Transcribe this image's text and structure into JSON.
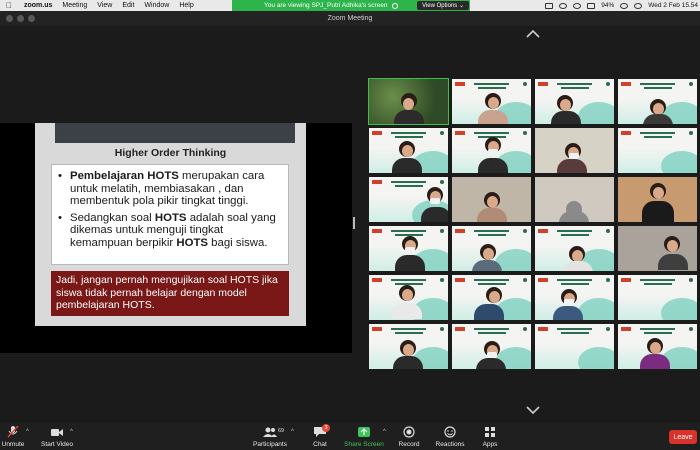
{
  "menubar": {
    "app": "zoom.us",
    "items": [
      "Meeting",
      "View",
      "Edit",
      "Window",
      "Help"
    ],
    "battery": "94%",
    "clock": "Wed 2 Feb  15.54"
  },
  "share_banner": {
    "text": "You are viewing SPJ_Putri Adhika's screen",
    "options_label": "View Options ⌄"
  },
  "window": {
    "title": "Zoom Meeting"
  },
  "slide": {
    "heading": "Higher Order Thinking",
    "bullet1_bold": "Pembelajaran HOTS",
    "bullet1_rest": " merupakan cara untuk melatih, membiasakan , dan membentuk pola pikir tingkat tinggi.",
    "bullet2_a": "Sedangkan soal ",
    "bullet2_b": "HOTS",
    "bullet2_c": " adalah soal yang dikemas untuk menguji tingkat kemampuan berpikir ",
    "bullet2_d": "HOTS",
    "bullet2_e": " bagi siswa.",
    "callout": "Jadi, jangan pernah mengujikan soal HOTS jika siswa tidak pernah belajar dengan model pembelajaran HOTS."
  },
  "toolbar": {
    "unmute": "Unmute",
    "start_video": "Start Video",
    "participants": "Participants",
    "participants_count": "69",
    "chat": "Chat",
    "chat_badge": "3",
    "share_screen": "Share Screen",
    "record": "Record",
    "reactions": "Reactions",
    "apps": "Apps",
    "leave": "Leave"
  },
  "colors": {
    "share_green": "#2db44a",
    "leave_red": "#d8322b",
    "callout_red": "#7a1717",
    "active_speaker": "#3fbf4a"
  }
}
